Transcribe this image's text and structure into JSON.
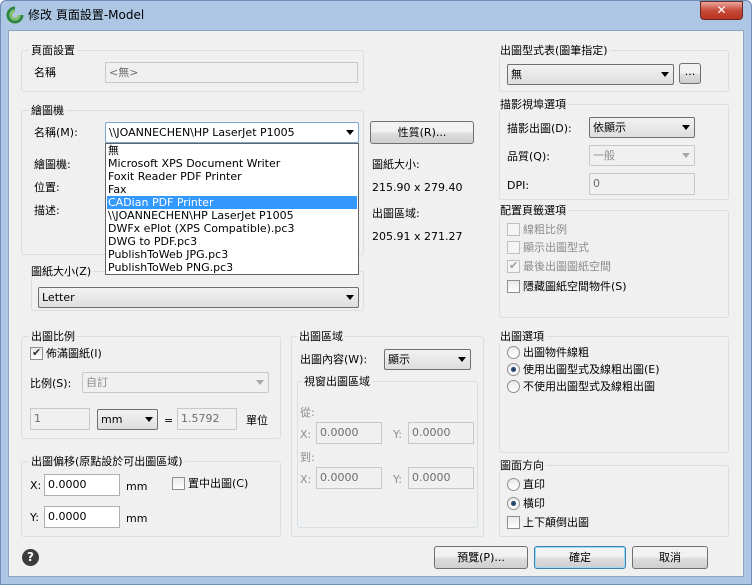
{
  "window": {
    "title": "修改 頁面設置-Model",
    "close_glyph": "✕"
  },
  "page_setup": {
    "group": "頁面設置",
    "name_label": "名稱",
    "name_value": "<無>"
  },
  "printer": {
    "group": "繪圖機",
    "name_label": "名稱(M):",
    "selected": "\\\\JOANNECHEN\\HP LaserJet P1005",
    "properties_button": "性質(R)...",
    "plotter_label": "繪圖機:",
    "location_label": "位置:",
    "description_label": "描述:",
    "paper_size_label": "圖紙大小:",
    "paper_size_value": "215.90 x 279.40",
    "print_area_label": "出圖區域:",
    "print_area_value": "205.91 x 271.27",
    "options": [
      "無",
      "Microsoft XPS Document Writer",
      "Foxit Reader PDF Printer",
      "Fax",
      "CADian PDF Printer",
      "\\\\JOANNECHEN\\HP LaserJet P1005",
      "DWFx ePlot (XPS Compatible).pc3",
      "DWG to PDF.pc3",
      "PublishToWeb JPG.pc3",
      "PublishToWeb PNG.pc3"
    ],
    "highlighted_index": 4
  },
  "paper_size": {
    "group": "圖紙大小(Z)",
    "value": "Letter"
  },
  "plot_scale": {
    "group": "出圖比例",
    "fit_label": "佈滿圖紙(I)",
    "scale_label": "比例(S):",
    "scale_value": "自訂",
    "left_value": "1",
    "unit_value": "mm",
    "equals": "=",
    "right_value": "1.5792",
    "unit_label": "單位"
  },
  "plot_offset": {
    "group": "出圖偏移(原點設於可出圖區域)",
    "x_label": "X:",
    "x_value": "0.0000",
    "x_unit": "mm",
    "y_label": "Y:",
    "y_value": "0.0000",
    "y_unit": "mm",
    "center_label": "置中出圖(C)"
  },
  "plot_area": {
    "group": "出圖區域",
    "what_label": "出圖內容(W):",
    "what_value": "顯示",
    "window_group": "視窗出圖區域",
    "from_label": "從:",
    "to_label": "到:",
    "x_label": "X:",
    "y_label": "Y:",
    "from_x": "0.0000",
    "from_y": "0.0000",
    "to_x": "0.0000",
    "to_y": "0.0000"
  },
  "plot_style": {
    "group": "出圖型式表(圖筆指定)",
    "value": "無",
    "edit_button": "..."
  },
  "shaded": {
    "group": "描影視埠選項",
    "shade_label": "描影出圖(D):",
    "shade_value": "依顯示",
    "quality_label": "品質(Q):",
    "quality_value": "一般",
    "dpi_label": "DPI:",
    "dpi_value": "0"
  },
  "options": {
    "group": "配置頁籤選項",
    "items": [
      "線粗比例",
      "顯示出圖型式",
      "最後出圖圖紙空間",
      "隱藏圖紙空間物件(S)"
    ]
  },
  "plot_options": {
    "group": "出圖選項",
    "items": [
      "出圖物件線粗",
      "使用出圖型式及線粗出圖(E)",
      "不使用出圖型式及線粗出圖"
    ]
  },
  "orientation": {
    "group": "圖面方向",
    "portrait": "直印",
    "landscape": "橫印",
    "upside_down": "上下顛倒出圖"
  },
  "buttons": {
    "help": "?",
    "preview": "預覽(P)...",
    "ok": "確定",
    "cancel": "取消"
  },
  "colors": {
    "frame": "#acc6e4",
    "highlight": "#3399ff",
    "close": "#c74b3a"
  }
}
